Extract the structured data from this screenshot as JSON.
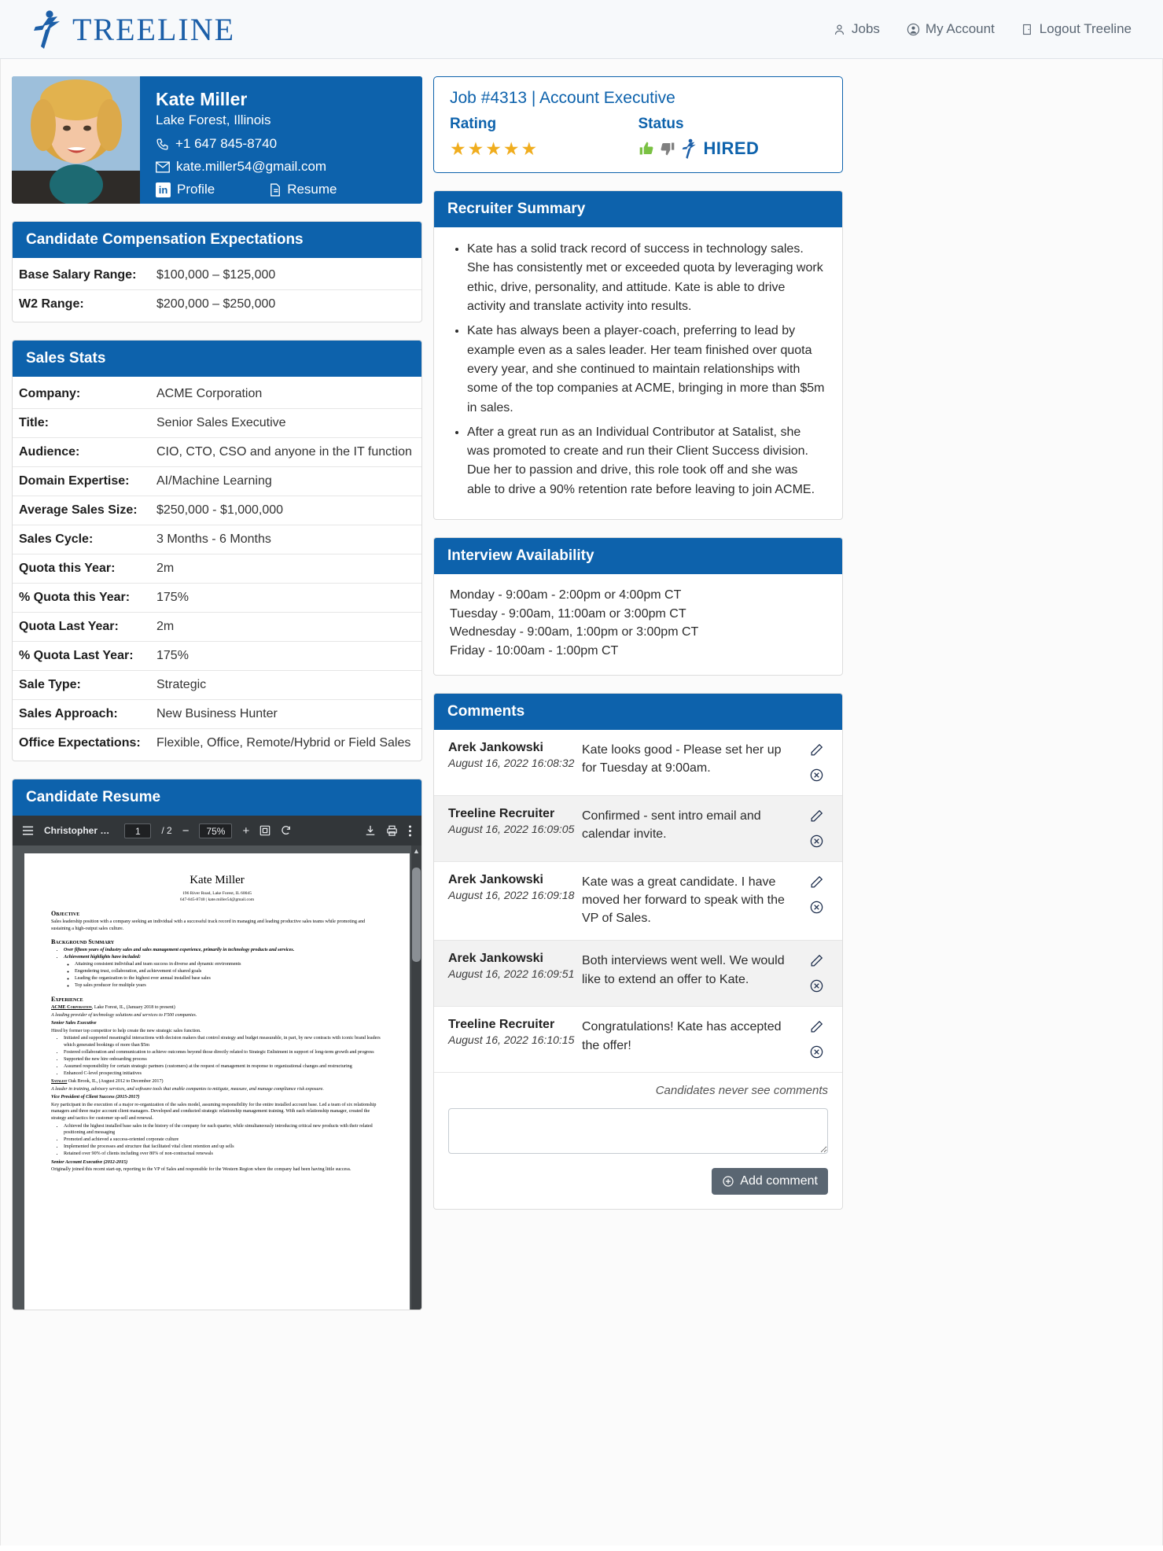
{
  "header": {
    "brand": "TREELINE",
    "nav": [
      {
        "label": "Jobs",
        "icon": "user-icon"
      },
      {
        "label": "My Account",
        "icon": "account-circle-icon"
      },
      {
        "label": "Logout Treeline",
        "icon": "logout-icon"
      }
    ]
  },
  "candidate": {
    "name": "Kate Miller",
    "location": "Lake Forest, Illinois",
    "phone": "+1 647 845-8740",
    "email": "kate.miller54@gmail.com",
    "profile_link": "Profile",
    "resume_link": "Resume"
  },
  "compensation": {
    "title": "Candidate Compensation Expectations",
    "rows": [
      {
        "label": "Base Salary Range:",
        "value": "$100,000 – $125,000"
      },
      {
        "label": "W2 Range:",
        "value": "$200,000 – $250,000"
      }
    ]
  },
  "sales_stats": {
    "title": "Sales Stats",
    "rows": [
      {
        "label": "Company:",
        "value": "ACME Corporation"
      },
      {
        "label": "Title:",
        "value": "Senior Sales Executive"
      },
      {
        "label": "Audience:",
        "value": "CIO, CTO, CSO and anyone in the IT function"
      },
      {
        "label": "Domain Expertise:",
        "value": "AI/Machine Learning"
      },
      {
        "label": "Average Sales Size:",
        "value": "$250,000 - $1,000,000"
      },
      {
        "label": "Sales Cycle:",
        "value": "3 Months - 6 Months"
      },
      {
        "label": "Quota this Year:",
        "value": "2m"
      },
      {
        "label": "% Quota this Year:",
        "value": "175%"
      },
      {
        "label": "Quota Last Year:",
        "value": "2m"
      },
      {
        "label": "% Quota Last Year:",
        "value": "175%"
      },
      {
        "label": "Sale Type:",
        "value": "Strategic"
      },
      {
        "label": "Sales Approach:",
        "value": "New Business Hunter"
      },
      {
        "label": "Office Expectations:",
        "value": "Flexible, Office, Remote/Hybrid or Field Sales"
      }
    ]
  },
  "resume_panel": {
    "title": "Candidate Resume",
    "viewer": {
      "doc_title": "Christopher …",
      "page_current": "1",
      "page_total": "/ 2",
      "zoom": "75%",
      "zoom_out": "−",
      "zoom_in": "+",
      "icons": [
        "menu-icon",
        "fit-page-icon",
        "rotate-icon",
        "download-icon",
        "print-icon",
        "more-options-icon"
      ]
    },
    "document": {
      "name": "Kate Miller",
      "address": "196 River Road, Lake Forest, IL 60045",
      "contact": "647-845-8740 | kate.miller54@gmail.com",
      "objective_heading": "Objective",
      "objective_text": "Sales leadership position with a company seeking an individual with a successful track record in managing and leading productive sales teams while promoting and sustaining a high-output sales culture.",
      "background_heading": "Background Summary",
      "background_items": [
        "Over fifteen years of industry sales and sales management experience, primarily in technology products and services.",
        "Achievement highlights have included:"
      ],
      "background_sub": [
        "Attaining consistent individual and team success in diverse and dynamic environments",
        "Engendering trust, collaboration, and achievement of shared goals",
        "Leading the organization to the highest ever annual installed base sales",
        "Top sales producer for multiple years"
      ],
      "experience_heading": "Experience",
      "jobs": [
        {
          "company": "ACME Corporation",
          "meta": ", Lake Forest, IL, (January 2018 to present)",
          "descriptor": "A leading provider of technology solutions and services to F500 companies.",
          "role": "Senior Sales Executive",
          "intro": "Hired by former top competitor to help create the new strategic sales function.",
          "bullets": [
            "Initiated and supported meaningful interactions with decision makers that control strategy and budget measurable, in part, by new contracts with iconic brand leaders which generated bookings of more than $5m",
            "Fostered collaboration and communication to achieve outcomes beyond those directly related to Strategic Enlistment in support of long-term growth and progress",
            "Supported the new hire onboarding process",
            "Assumed responsibility for certain strategic partners (customers) at the request of management in response to organizational changes and restructuring",
            "Enhanced C-level prospecting initiatives"
          ]
        },
        {
          "company": "Satalist",
          "meta": " Oak Brook, IL, (August 2012 to December 2017)",
          "descriptor": "A leader in training, advisory services, and software tools that enable companies to mitigate, measure, and manage compliance risk exposure.",
          "role": "Vice President of Client Success (2015-2017)",
          "intro": "Key participant in the execution of a major re-organization of the sales model, assuming responsibility for the entire installed account base.  Led a team of six relationship managers and three major account client managers. Developed and conducted strategic relationship management training.  With each relationship manager, created the strategy and tactics for customer up-sell and renewal.",
          "bullets": [
            "Achieved the highest installed base sales in the history of the company for each quarter, while simultaneously introducing critical new products with their related positioning and messaging",
            "Promoted and achieved a success-oriented corporate culture",
            "Implemented the processes and structure that facilitated vital client retention and up sells",
            "Retained over 90% of clients including over 80% of non-contractual renewals"
          ]
        },
        {
          "company": "",
          "meta": "",
          "descriptor": "",
          "role": "Senior Account Executive (2012-2015)",
          "intro": "Originally joined this recent start-up, reporting to the VP of Sales and responsible for the Western Region where the company had been having little success.",
          "bullets": []
        }
      ]
    }
  },
  "job": {
    "title": "Job #4313 | Account Executive",
    "rating_label": "Rating",
    "status_label": "Status",
    "stars": "★★★★★",
    "stars_count": 5,
    "status_text": "HIRED",
    "thumbs_up_icon": "thumbs-up-icon",
    "thumbs_down_icon": "thumbs-down-icon",
    "brand_icon": "treeline-mark-icon",
    "accent_color": "#0d62ac",
    "star_color": "#f0ad1e",
    "thumbs_up_color": "#7ac143",
    "thumbs_down_color": "#808080"
  },
  "recruiter_summary": {
    "title": "Recruiter Summary",
    "bullets": [
      "Kate has a solid track record of success in technology sales. She has consistently met or exceeded quota by leveraging work ethic, drive, personality, and attitude. Kate is able to drive activity and translate activity into results.",
      "Kate has always been a player-coach, preferring to lead by example even as a sales leader.  Her team finished over quota every year, and she continued to maintain relationships with some of the top companies at ACME, bringing in more than $5m in sales.",
      "After a great run as an Individual Contributor at Satalist, she was promoted to create and run their Client Success division.  Due her to passion and drive, this role took off and she was able to drive a 90% retention rate before leaving to join ACME."
    ]
  },
  "availability": {
    "title": "Interview Availability",
    "lines": [
      "Monday - 9:00am - 2:00pm or 4:00pm CT",
      "Tuesday - 9:00am, 11:00am or 3:00pm CT",
      "Wednesday - 9:00am, 1:00pm or 3:00pm CT",
      "Friday - 10:00am - 1:00pm CT"
    ]
  },
  "comments": {
    "title": "Comments",
    "items": [
      {
        "author": "Arek Jankowski",
        "date": "August 16, 2022 16:08:32",
        "text": "Kate looks good - Please set her up for Tuesday at 9:00am."
      },
      {
        "author": "Treeline Recruiter",
        "date": "August 16, 2022 16:09:05",
        "text": "Confirmed - sent intro email and calendar invite."
      },
      {
        "author": "Arek Jankowski",
        "date": "August 16, 2022 16:09:18",
        "text": "Kate was a great candidate. I have moved her forward to speak with the VP of Sales."
      },
      {
        "author": "Arek Jankowski",
        "date": "August 16, 2022 16:09:51",
        "text": "Both interviews went well. We would like to extend an offer to Kate."
      },
      {
        "author": "Treeline Recruiter",
        "date": "August 16, 2022 16:10:15",
        "text": "Congratulations! Kate has accepted the offer!"
      }
    ],
    "note": "Candidates never see comments",
    "input_placeholder": "",
    "input_value": "",
    "add_button": "Add comment"
  }
}
